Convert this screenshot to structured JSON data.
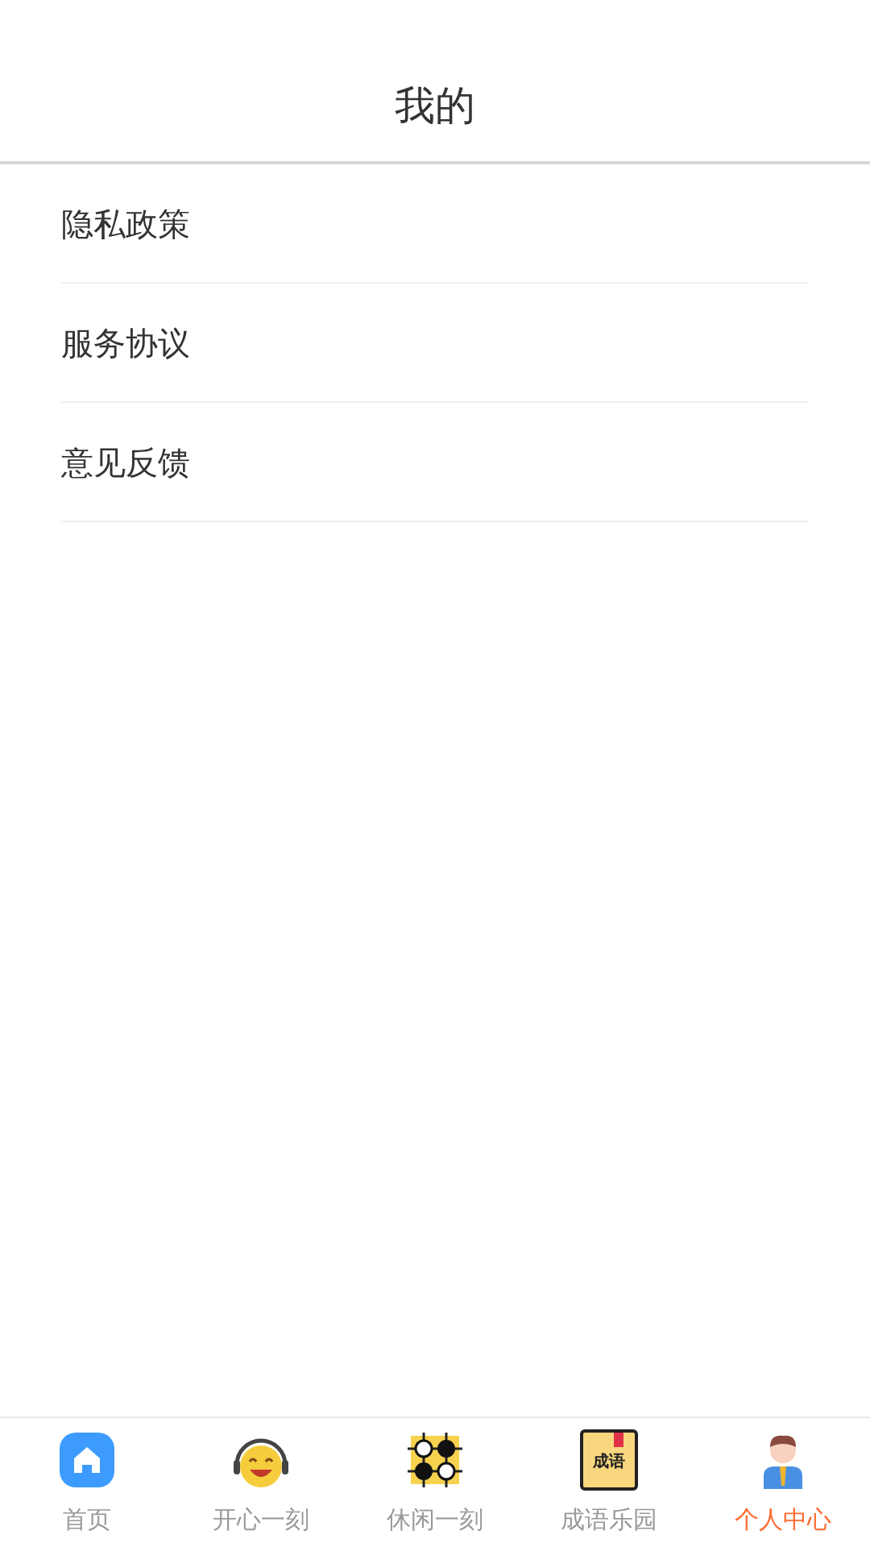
{
  "header": {
    "title": "我的"
  },
  "menu": [
    {
      "label": "隐私政策"
    },
    {
      "label": "服务协议"
    },
    {
      "label": "意见反馈"
    }
  ],
  "tabs": [
    {
      "kind": "home",
      "label": "首页",
      "selected": false
    },
    {
      "kind": "smiley",
      "label": "开心一刻",
      "selected": false
    },
    {
      "kind": "go",
      "label": "休闲一刻",
      "selected": false
    },
    {
      "kind": "book",
      "label": "成语乐园",
      "icon_text": "成语",
      "selected": false
    },
    {
      "kind": "person",
      "label": "个人中心",
      "selected": true
    }
  ]
}
